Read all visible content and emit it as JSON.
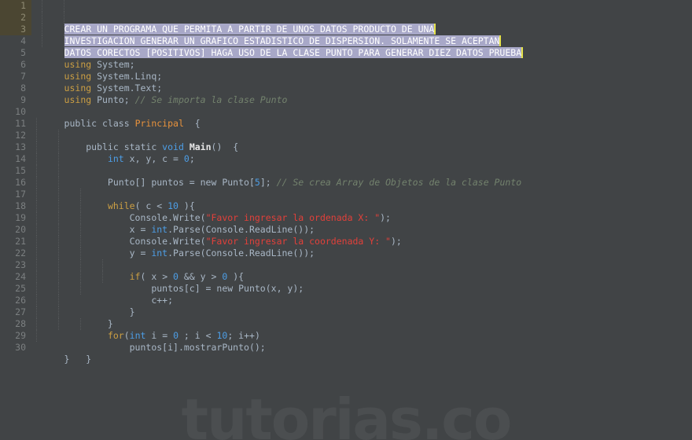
{
  "editor": {
    "language": "C#",
    "watermark": "tutorias.co",
    "total_lines": 30,
    "colors": {
      "background": "#414446",
      "gutter_background": "#414446",
      "gutter_selected_background": "#4b4632",
      "line_number": "#7b7f80",
      "default_text": "#a9b7c6",
      "keyword": "#cc9f43",
      "type": "#4d9ee6",
      "number": "#4d9ee6",
      "class_name": "#e8923c",
      "method_name": "#e8e8e8",
      "string": "#e2403a",
      "comment": "#73826d",
      "selection": "#a8a8c8",
      "caret": "#e6e34a",
      "indent_guide": "#55585a",
      "watermark": "#4b4e50"
    }
  },
  "line_numbers": [
    "1",
    "2",
    "3",
    "4",
    "5",
    "6",
    "7",
    "8",
    "9",
    "10",
    "11",
    "12",
    "13",
    "14",
    "15",
    "16",
    "17",
    "18",
    "19",
    "20",
    "21",
    "22",
    "23",
    "24",
    "25",
    "26",
    "27",
    "28",
    "29",
    "30"
  ],
  "selected_line_numbers": [
    "1",
    "2",
    "3"
  ],
  "selected_comment_block": {
    "line1": "CREAR UN PROGRAMA QUE PERMITA A PARTIR DE UNOS DATOS PRODUCTO DE UNA",
    "line2": "INVESTIGACION GENERAR UN GRAFICO ESTADISTICO DE DISPERSION. SOLAMENTE SE ACEPTAN",
    "line3": "DATOS CORECTOS [POSITIVOS] HAGA USO DE LA CLASE PUNTO PARA GENERAR DIEZ DATOS PRUEBA"
  },
  "code": {
    "l5_using": "using",
    "l5_rest": " System;",
    "l6_using": "using",
    "l6_rest": " System.Linq;",
    "l7_using": "using",
    "l7_rest": " System.Text;",
    "l8_using": "using",
    "l8_rest": " Punto; ",
    "l8_comment": "// Se importa la clase Punto",
    "l10_a": "public class ",
    "l10_class": "Principal",
    "l10_b": "  {",
    "l11_a": "    public static ",
    "l11_void": "void",
    "l11_sp": " ",
    "l11_main": "Main",
    "l11_b": "()  {",
    "l12_a": "        ",
    "l12_int": "int",
    "l12_b": " x, y, c = ",
    "l12_num": "0",
    "l12_c": ";",
    "l14_a": "        Punto[] puntos = new Punto[",
    "l14_num": "5",
    "l14_b": "]; ",
    "l14_comment": "// Se crea Array de Objetos de la clase Punto",
    "l16_a": "        ",
    "l16_kw": "while",
    "l16_b": "( c < ",
    "l16_num": "10",
    "l16_c": " ){",
    "l17_a": "            Console.Write(",
    "l17_str": "\"Favor ingresar la ordenada X: \"",
    "l17_b": ");",
    "l18_a": "            x = ",
    "l18_int": "int",
    "l18_b": ".Parse(Console.ReadLine());",
    "l19_a": "            Console.Write(",
    "l19_str": "\"Favor ingresar la coordenada Y: \"",
    "l19_b": ");",
    "l20_a": "            y = ",
    "l20_int": "int",
    "l20_b": ".Parse(Console.ReadLine());",
    "l22_a": "            ",
    "l22_kw": "if",
    "l22_b": "( x > ",
    "l22_num1": "0",
    "l22_c": " && y > ",
    "l22_num2": "0",
    "l22_d": " ){",
    "l23": "                puntos[c] = new Punto(x, y);",
    "l24": "                c++;",
    "l25": "            }",
    "l26": "        }",
    "l27_a": "        ",
    "l27_kw": "for",
    "l27_b": "(",
    "l27_int": "int",
    "l27_c": " i = ",
    "l27_num1": "0",
    "l27_d": " ; i < ",
    "l27_num2": "10",
    "l27_e": "; i++)",
    "l28": "            puntos[i].mostrarPunto();",
    "l29": "    }",
    "l30": "}"
  }
}
